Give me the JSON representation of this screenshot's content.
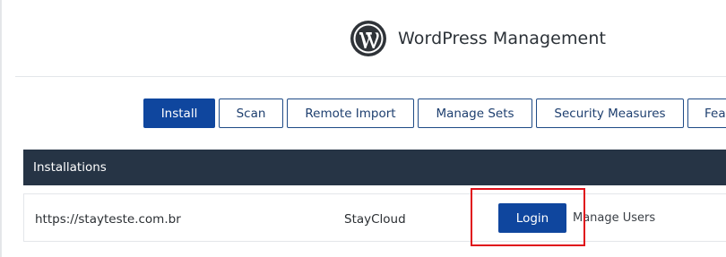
{
  "header": {
    "title": "WordPress Management",
    "logo_icon": "wordpress-logo-icon"
  },
  "toolbar": {
    "tabs": [
      {
        "label": "Install",
        "active": true
      },
      {
        "label": "Scan",
        "active": false
      },
      {
        "label": "Remote Import",
        "active": false
      },
      {
        "label": "Manage Sets",
        "active": false
      },
      {
        "label": "Security Measures",
        "active": false
      },
      {
        "label": "Fea",
        "active": false
      }
    ]
  },
  "installations": {
    "heading": "Installations",
    "rows": [
      {
        "url": "https://stayteste.com.br",
        "user": "StayCloud",
        "login_label": "Login",
        "manage_users_label": "Manage Users"
      }
    ]
  },
  "colors": {
    "primary": "#0f469e",
    "table_header_bg": "#263445",
    "highlight": "#e0121b",
    "background": "#ffffff"
  }
}
